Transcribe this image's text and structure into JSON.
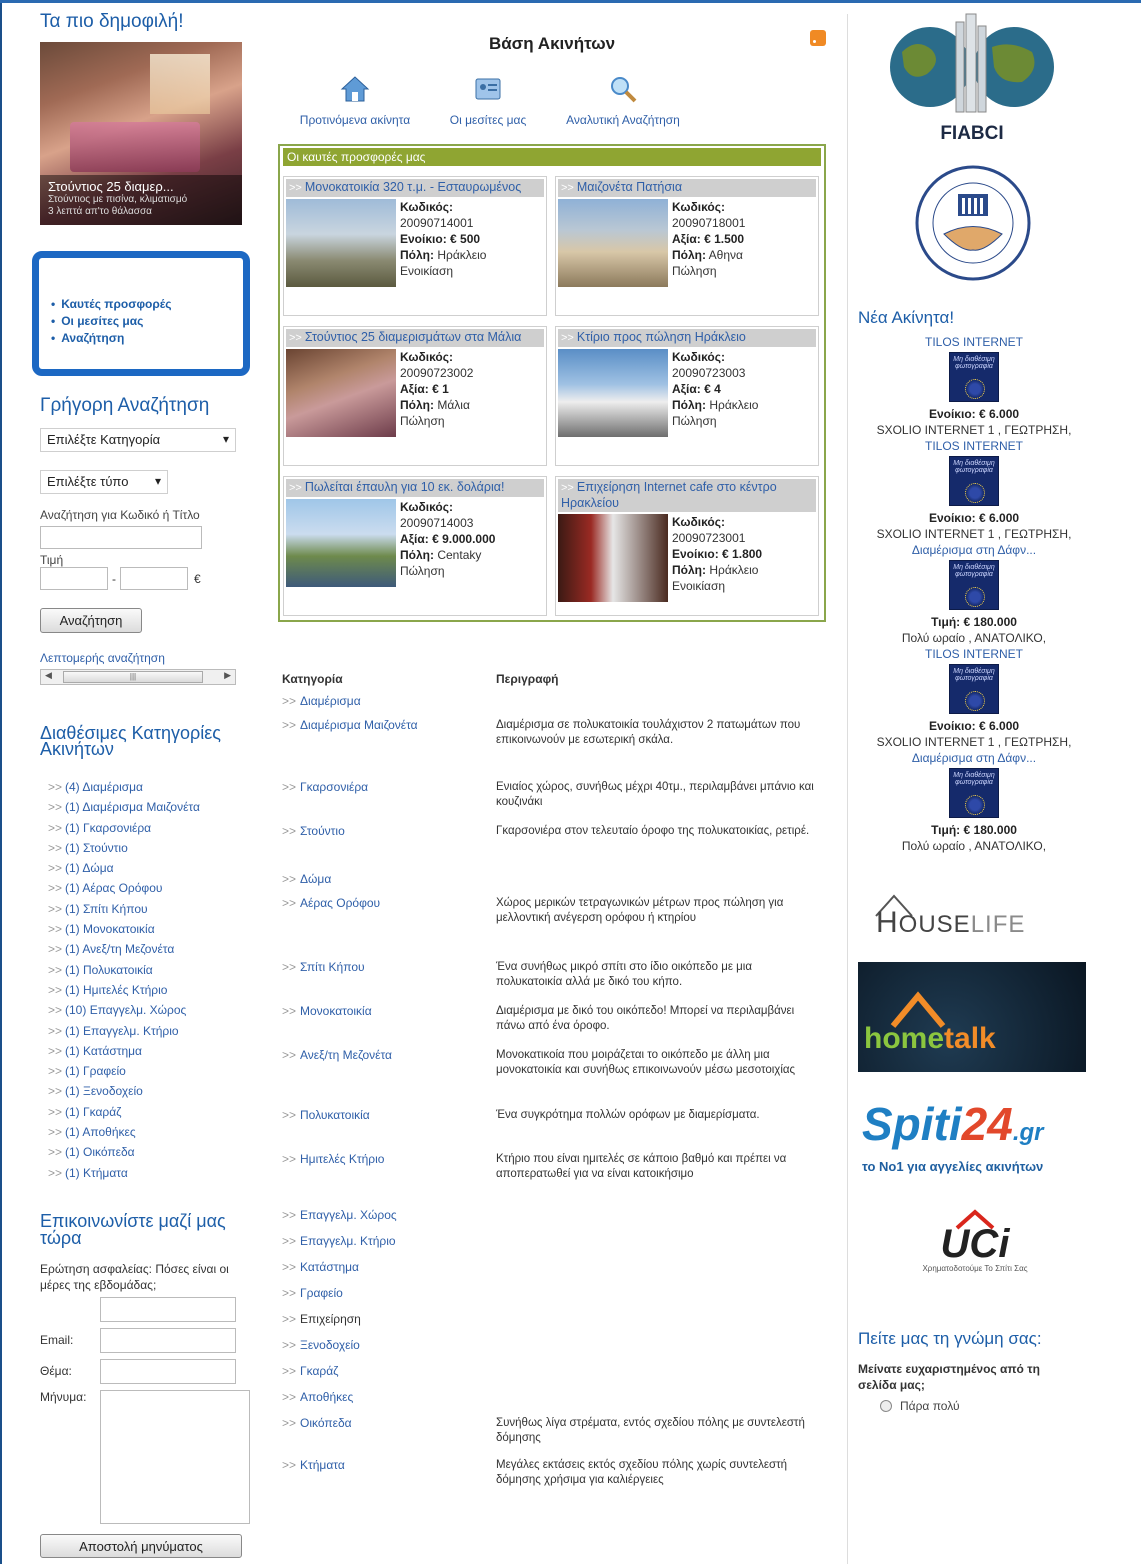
{
  "left": {
    "popular_title": "Τα πιο δημοφιλή!",
    "popular_caption_title": "Στούντιος 25 διαμερ...",
    "popular_caption_sub": "Στούντιος με πισίνα, κλιματισμό\n3 λεπτά απ'το θάλασσα",
    "menu": [
      "Καυτές προσφορές",
      "Οι μεσίτες μας",
      "Αναζήτηση"
    ],
    "quick_search_title": "Γρήγορη Αναζήτηση",
    "select_category": "Επιλέξτε Κατηγορία",
    "select_type": "Επιλέξτε τύπο",
    "search_code_label": "Αναζήτηση για Κωδικό ή Τίτλο",
    "price_label": "Τιμή",
    "price_sep": "-",
    "currency": "€",
    "search_button": "Αναζήτηση",
    "advanced_link": "Λεπτομερής αναζήτηση",
    "categories_title": "Διαθέσιμες Κατηγορίες Ακινήτων",
    "categories": [
      "(4) Διαμέρισμα",
      "(1) Διαμέρισμα Μαιζονέτα",
      "(1) Γκαρσονιέρα",
      "(1) Στούντιο",
      "(1) Δώμα",
      "(1) Αέρας Ορόφου",
      "(1) Σπίτι Κήπου",
      "(1) Μονοκατοικία",
      "(1) Ανεξ/τη Μεζονέτα",
      "(1) Πολυκατοικία",
      "(1) Ημιτελές Κτήριο",
      "(10) Επαγγελμ. Χώρος",
      "(1) Επαγγελμ. Κτήριο",
      "(1) Κατάστημα",
      "(1) Γραφείο",
      "(1) Ξενοδοχείο",
      "(1) Γκαράζ",
      "(1) Αποθήκες",
      "(1) Οικόπεδα",
      "(1) Κτήματα"
    ],
    "contact_title": "Επικοινωνίστε μαζί μας τώρα",
    "security_question": "Ερώτηση ασφαλείας: Πόσες είναι οι μέρες της εβδομάδας;",
    "email_label": "Email:",
    "subject_label": "Θέμα:",
    "message_label": "Μήνυμα:",
    "send_button": "Αποστολή μηνύματος"
  },
  "center": {
    "title": "Βάση Ακινήτων",
    "nav": [
      "Προτινόμενα ακίνητα",
      "Οι μεσίτες μας",
      "Αναλυτική Αναζήτηση"
    ],
    "offers_title": "Οι καυτές προσφορές μας",
    "offers": [
      {
        "title": "Μονοκατοικία 320 τ.μ. - Εσταυρωμένος",
        "code_label": "Κωδικός:",
        "code": "20090714001",
        "price_label": "Ενοίκιο:",
        "price": "€ 500",
        "city_label": "Πόλη:",
        "city": "Ηράκλειο",
        "deal": "Ενοικίαση"
      },
      {
        "title": "Μαιζονέτα Πατήσια",
        "code_label": "Κωδικός:",
        "code": "20090718001",
        "price_label": "Αξία:",
        "price": "€ 1.500",
        "city_label": "Πόλη:",
        "city": "Αθηνα",
        "deal": "Πώληση"
      },
      {
        "title": "Στούντιος 25 διαμερισμάτων στα Μάλια",
        "code_label": "Κωδικός:",
        "code": "20090723002",
        "price_label": "Αξία:",
        "price": "€ 1",
        "city_label": "Πόλη:",
        "city": "Μάλια",
        "deal": "Πώληση"
      },
      {
        "title": "Κτίριο προς πώληση Ηράκλειο",
        "code_label": "Κωδικός:",
        "code": "20090723003",
        "price_label": "Αξία:",
        "price": "€ 4",
        "city_label": "Πόλη:",
        "city": "Ηράκλειο",
        "deal": "Πώληση"
      },
      {
        "title": "Πωλείται έπαυλη για 10 εκ. δολάρια!",
        "code_label": "Κωδικός:",
        "code": "20090714003",
        "price_label": "Αξία:",
        "price": "€ 9.000.000",
        "city_label": "Πόλη:",
        "city": "Centaky",
        "deal": "Πώληση"
      },
      {
        "title": "Επιχείρηση Internet cafe στο κέντρο Ηρακλείου",
        "code_label": "Κωδικός:",
        "code": "20090723001",
        "price_label": "Ενοίκιο:",
        "price": "€ 1.800",
        "city_label": "Πόλη:",
        "city": "Ηράκλειο",
        "deal": "Ενοικίαση"
      }
    ],
    "table_header": {
      "category": "Κατηγορία",
      "description": "Περιγραφή"
    },
    "table_rows": [
      {
        "cat": "Διαμέρισμα",
        "desc": ""
      },
      {
        "cat": "Διαμέρισμα Μαιζονέτα",
        "desc": "Διαμέρισμα σε πολυκατοικία τουλάχιστον 2 πατωμάτων που επικοινωνούν με εσωτερική σκάλα."
      },
      {
        "cat": "Γκαρσονιέρα",
        "desc": "Ενιαίος χώρος, συνήθως μέχρι 40τμ., περιλαμβάνει μπάνιο και κουζινάκι"
      },
      {
        "cat": "Στούντιο",
        "desc": "Γκαρσονιέρα στον τελευταίο όροφο της πολυκατοικίας, ρετιρέ."
      },
      {
        "cat": "Δώμα",
        "desc": ""
      },
      {
        "cat": "Αέρας Ορόφου",
        "desc": "Χώρος μερικών τετραγωνικών μέτρων προς πώληση για μελλοντική ανέγερση ορόφου ή κτηρίου"
      },
      {
        "cat": "Σπίτι Κήπου",
        "desc": "Ένα συνήθως μικρό σπίτι στο ίδιο οικόπεδο με μια πολυκατοικία αλλά με δικό του κήπο."
      },
      {
        "cat": "Μονοκατοικία",
        "desc": "Διαμέρισμα με δικό του οικόπεδο! Μπορεί να περιλαμβάνει πάνω από ένα όροφο."
      },
      {
        "cat": "Ανεξ/τη Μεζονέτα",
        "desc": "Μονοκατικοία που μοιράζεται το οικόπεδο με άλλη μια μονοκατοικία και συνήθως επικοινωνούν μέσω μεσοτοιχίας"
      },
      {
        "cat": "Πολυκατοικία",
        "desc": "Ένα συγκρότημα πολλών ορόφων με διαμερίσματα."
      },
      {
        "cat": "Ημιτελές Κτήριο",
        "desc": "Κτήριο που είναι ημιτελές σε κάποιο βαθμό και πρέπει να αποπερατωθεί για να είναι κατοικήσιμο"
      },
      {
        "cat": "Επαγγελμ. Χώρος",
        "desc": ""
      },
      {
        "cat": "Επαγγελμ. Κτήριο",
        "desc": ""
      },
      {
        "cat": "Κατάστημα",
        "desc": ""
      },
      {
        "cat": "Γραφείο",
        "desc": ""
      },
      {
        "cat": "Επιχείρηση",
        "desc": ""
      },
      {
        "cat": "Ξενοδοχείο",
        "desc": ""
      },
      {
        "cat": "Γκαράζ",
        "desc": ""
      },
      {
        "cat": "Αποθήκες",
        "desc": ""
      },
      {
        "cat": "Οικόπεδα",
        "desc": "Συνήθως λίγα στρέματα, εντός σχεδίου πόλης με συντελεστή δόμησης"
      },
      {
        "cat": "Κτήματα",
        "desc": "Μεγάλες εκτάσεις εκτός σχεδίου πόλης χωρίς συντελεστή δόμησης χρήσιμα για καλιέργειες"
      }
    ]
  },
  "right": {
    "fiabci": "FIABCI",
    "new_title": "Νέα Ακίνητα!",
    "thumb_text": "Μη διαθέσιμη φωτογραφία",
    "listings": [
      {
        "title": "TILOS INTERNET",
        "price_label": "Ενοίκιο:",
        "price": "€ 6.000",
        "desc": "SXOLIO INTERNET 1 , ΓΕΩΤΡΗΣΗ,"
      },
      {
        "title": "TILOS INTERNET",
        "price_label": "Ενοίκιο:",
        "price": "€ 6.000",
        "desc": "SXOLIO INTERNET 1 , ΓΕΩΤΡΗΣΗ,"
      },
      {
        "title": "Διαμέρισμα στη Δάφν...",
        "price_label": "Τιμή:",
        "price": "€ 180.000",
        "desc": "Πολύ ωραίο , ΑΝΑΤΟΛΙΚΟ,"
      },
      {
        "title": "TILOS INTERNET",
        "price_label": "Ενοίκιο:",
        "price": "€ 6.000",
        "desc": "SXOLIO INTERNET 1 , ΓΕΩΤΡΗΣΗ,"
      },
      {
        "title": "Διαμέρισμα στη Δάφν...",
        "price_label": "Τιμή:",
        "price": "€ 180.000",
        "desc": "Πολύ ωραίο , ΑΝΑΤΟΛΙΚΟ,"
      }
    ],
    "houselife_a": "H",
    "houselife_b": "OUSE",
    "houselife_c": "LIFE",
    "hometalk_a": "home",
    "hometalk_b": "talk",
    "spiti_a": "Spiti",
    "spiti_b": "24",
    "spiti_c": ".gr",
    "spiti_tag": "το Νο1 για αγγελίες ακινήτων",
    "uci": "UCi",
    "uci_tag": "Χρηματοδοτούμε Το Σπίτι Σας",
    "poll_title": "Πείτε μας τη γνώμη σας:",
    "poll_question": "Μείνατε ευχαριστημένος από τη σελίδα μας;",
    "poll_option": "Πάρα πολύ"
  }
}
